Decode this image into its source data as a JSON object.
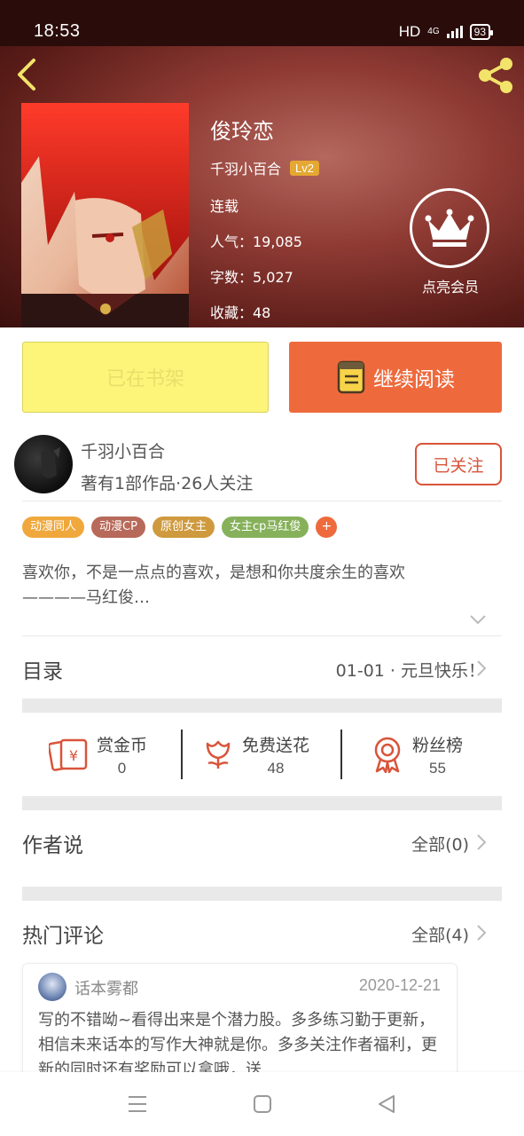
{
  "status_bar": {
    "time": "18:53",
    "hd": "HD",
    "network": "4G",
    "battery": "93"
  },
  "book": {
    "title": "俊玲恋",
    "author": "千羽小百合",
    "level": "Lv2",
    "status": "连载",
    "popularity": "人气：19,085",
    "word_count": "字数：5,027",
    "favorites": "收藏：48"
  },
  "vip": {
    "label": "点亮会员"
  },
  "actions": {
    "shelf_label": "已在书架",
    "read_label": "继续阅读"
  },
  "author": {
    "name": "千羽小百合",
    "stats": "著有1部作品·26人关注",
    "follow_label": "已关注"
  },
  "tags": [
    {
      "label": "动漫同人",
      "color": "#f0a83c"
    },
    {
      "label": "动漫CP",
      "color": "#b7695a"
    },
    {
      "label": "原创女主",
      "color": "#cf9a3e"
    },
    {
      "label": "女主cp马红俊",
      "color": "#86b15a"
    }
  ],
  "tag_more": "+",
  "intro": "喜欢你，不是一点点的喜欢，是想和你共度余生的喜欢\n————马红俊…",
  "catalog": {
    "label": "目录",
    "latest": "01-01 · 元旦快乐！"
  },
  "stats": {
    "coins": {
      "label": "赏金币",
      "value": "0"
    },
    "flowers": {
      "label": "免费送花",
      "value": "48"
    },
    "fans": {
      "label": "粉丝榜",
      "value": "55"
    }
  },
  "author_says": {
    "label": "作者说",
    "all": "全部(0)"
  },
  "hot_comments": {
    "label": "热门评论",
    "all": "全部(4)"
  },
  "comment": {
    "user": "话本雾都",
    "date": "2020-12-21",
    "text": "写的不错呦~看得出来是个潜力股。多多练习勤于更新，相信未来话本的写作大神就是你。多多关注作者福利，更新的同时还有奖励可以拿哦，送"
  },
  "colors": {
    "accent": "#ee6a3d",
    "follow": "#d9543a",
    "shelf": "#fcf57a",
    "stat_icon": "#d9543a"
  }
}
